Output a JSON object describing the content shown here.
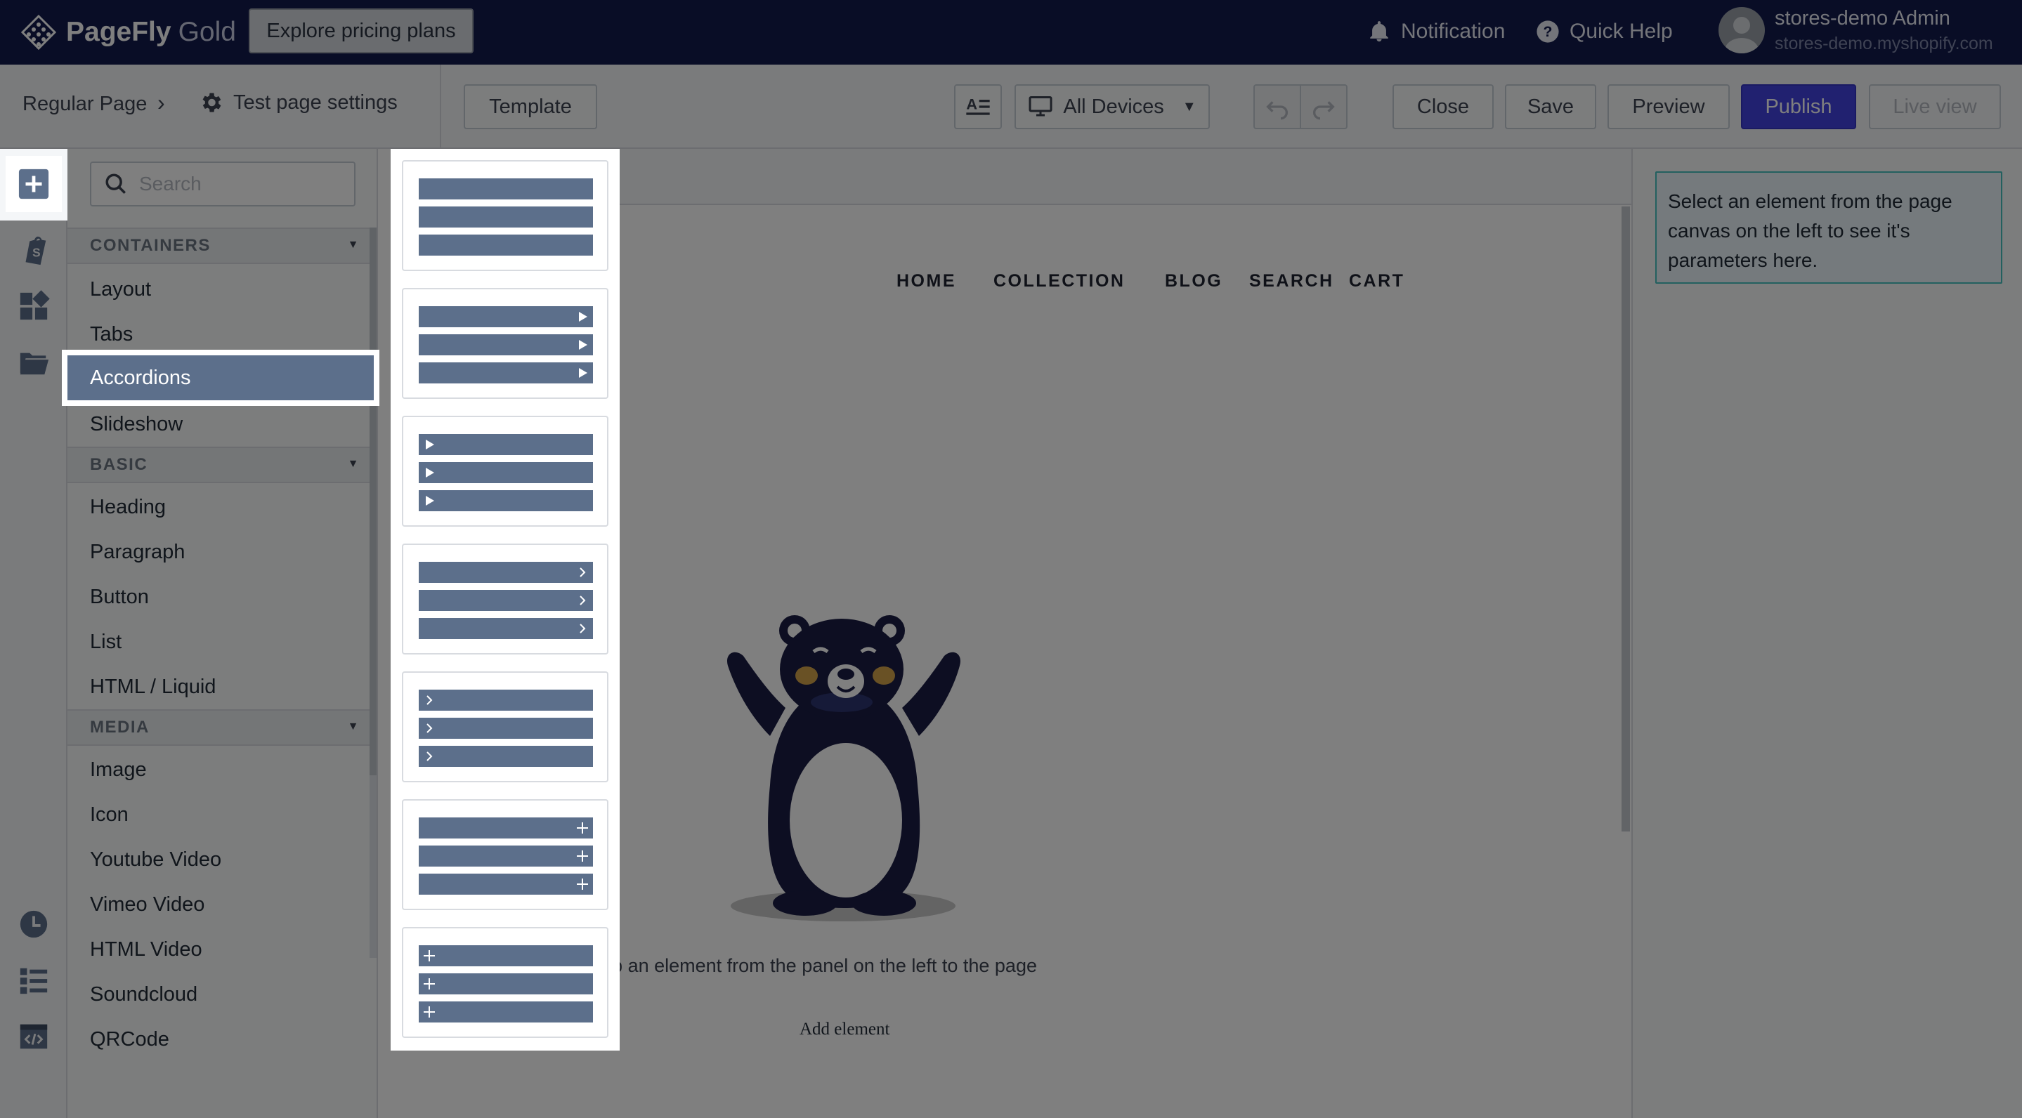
{
  "brand": {
    "name": "PageFly",
    "tier": "Gold"
  },
  "header": {
    "pricing_button": "Explore pricing plans",
    "notification": "Notification",
    "quick_help": "Quick Help",
    "user_name": "stores-demo Admin",
    "user_store": "stores-demo.myshopify.com"
  },
  "toolbar": {
    "breadcrumb": "Regular Page",
    "page_settings": "Test page settings",
    "template": "Template",
    "device": "All Devices",
    "close": "Close",
    "save": "Save",
    "preview": "Preview",
    "publish": "Publish",
    "live_view": "Live view"
  },
  "panel": {
    "search_placeholder": "Search",
    "groups": {
      "containers": "CONTAINERS",
      "basic": "BASIC",
      "media": "MEDIA"
    },
    "items": {
      "layout": "Layout",
      "tabs": "Tabs",
      "accordions": "Accordions",
      "slideshow": "Slideshow",
      "heading": "Heading",
      "paragraph": "Paragraph",
      "button": "Button",
      "list": "List",
      "html_liquid": "HTML / Liquid",
      "image": "Image",
      "icon": "Icon",
      "youtube": "Youtube Video",
      "vimeo": "Vimeo Video",
      "html_video": "HTML Video",
      "soundcloud": "Soundcloud",
      "qrcode": "QRCode"
    }
  },
  "accordion_variants": [
    "plain",
    "arrow-right",
    "arrow-left",
    "chevron-right",
    "chevron-left",
    "plus-right",
    "plus-left"
  ],
  "canvas": {
    "nav": [
      "HOME",
      "COLLECTION",
      "BLOG",
      "SEARCH",
      "CART"
    ],
    "drag_text": "rag & drop an element from the panel on the left to the page",
    "add_element": "Add element"
  },
  "inspector": {
    "hint": "Select an element from the page canvas on the left to see it's parameters here."
  },
  "colors": {
    "topbar": "#121a4d",
    "publish": "#4343e0",
    "accent_item": "#5c6f8b",
    "hint_border": "#47c1bf"
  },
  "icons": {
    "rail": [
      "add-element-icon",
      "shopify-icon",
      "sections-icon",
      "folder-icon",
      "history-icon",
      "layers-icon",
      "code-icon"
    ]
  }
}
